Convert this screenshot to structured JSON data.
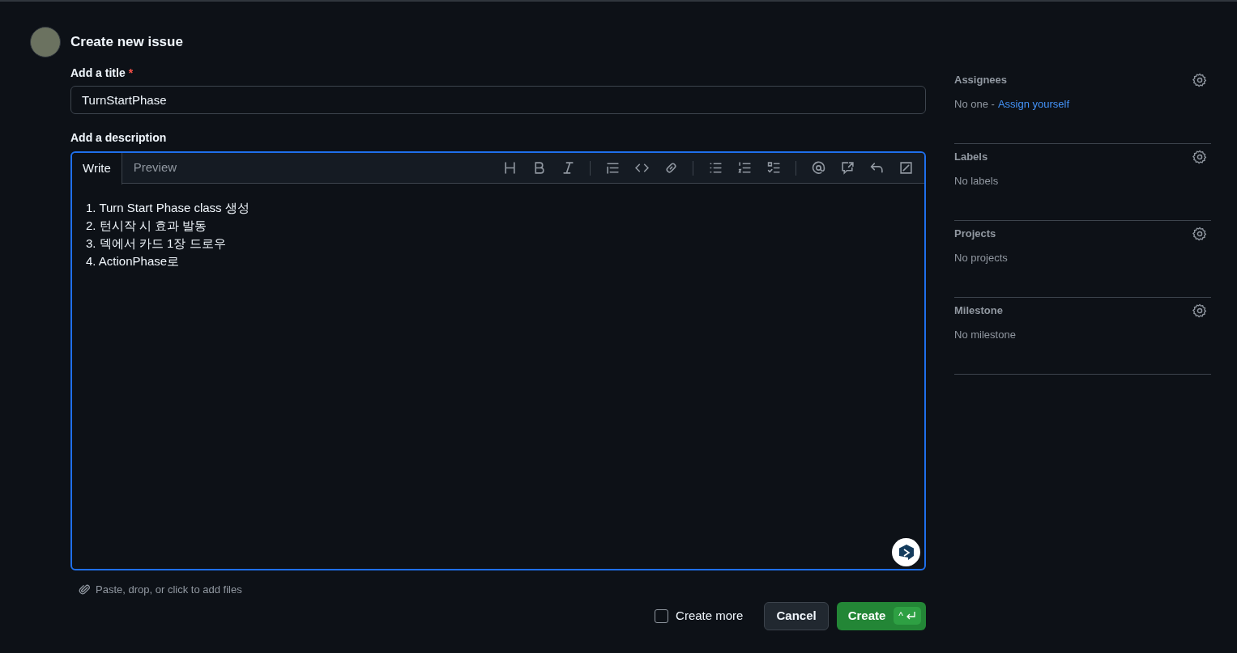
{
  "header": {
    "title": "Create new issue"
  },
  "title_field": {
    "label": "Add a title",
    "required_mark": "*",
    "value": "TurnStartPhase"
  },
  "description": {
    "label": "Add a description",
    "tabs": [
      {
        "label": "Write",
        "selected": true
      },
      {
        "label": "Preview",
        "selected": false
      }
    ],
    "lines": [
      "1. Turn Start Phase class 생성",
      "2. 턴시작 시 효과 발동",
      "3. 덱에서 카드 1장 드로우",
      "4. ActionPhase로"
    ]
  },
  "attach_hint": "Paste, drop, or click to add files",
  "create_more": {
    "label": "Create more",
    "checked": false
  },
  "buttons": {
    "cancel": "Cancel",
    "create": "Create",
    "create_shortcut": "^"
  },
  "sidebar": [
    {
      "heading": "Assignees",
      "value": "No one -",
      "link": "Assign yourself"
    },
    {
      "heading": "Labels",
      "value": "No labels"
    },
    {
      "heading": "Projects",
      "value": "No projects"
    },
    {
      "heading": "Milestone",
      "value": "No milestone"
    }
  ]
}
